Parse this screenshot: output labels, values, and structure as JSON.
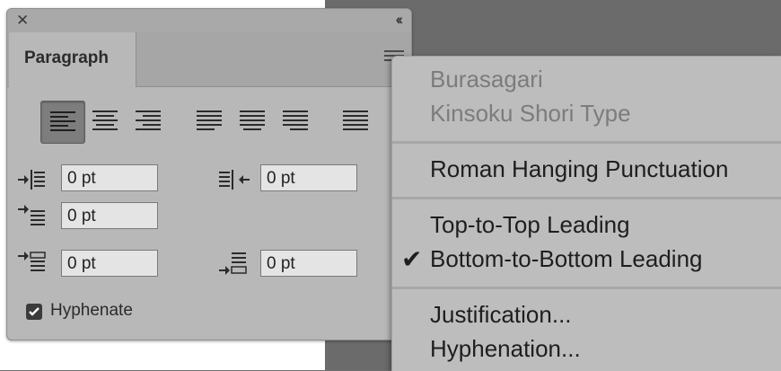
{
  "panel": {
    "tab_label": "Paragraph"
  },
  "indents": {
    "left_indent": "0 pt",
    "right_indent": "0 pt",
    "first_line_indent": "0 pt",
    "space_before": "0 pt",
    "space_after": "0 pt"
  },
  "hyphenate": {
    "label": "Hyphenate",
    "checked": true
  },
  "menu": {
    "items": [
      {
        "label": "Burasagari",
        "enabled": false
      },
      {
        "label": "Kinsoku Shori Type",
        "enabled": false
      },
      {
        "label": "Roman Hanging Punctuation",
        "enabled": true
      },
      {
        "label": "Top-to-Top Leading",
        "enabled": true
      },
      {
        "label": "Bottom-to-Bottom Leading",
        "enabled": true,
        "checked": true
      },
      {
        "label": "Justification...",
        "enabled": true
      },
      {
        "label": "Hyphenation...",
        "enabled": true
      }
    ]
  },
  "icons": {
    "close": "close-icon",
    "collapse": "double-chevron-left-icon",
    "panel_menu": "hamburger-menu-icon",
    "checked": "checkmark-icon"
  }
}
